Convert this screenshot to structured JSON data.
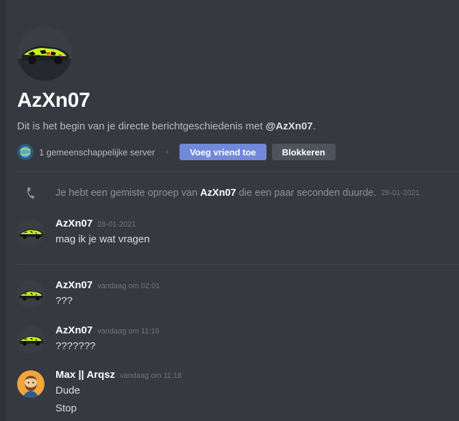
{
  "colors": {
    "background": "#36393f",
    "sidebar_strip": "#2f3136",
    "primary_button": "#7289da",
    "secondary_button": "#4f545c",
    "avatar_lime": "#c8f51e",
    "max_avatar_bg": "#f0a63a"
  },
  "header": {
    "avatar_icon": "lime-camo-supercar-avatar",
    "title": "AzXn07",
    "subtitle_prefix": "Dit is het begin van je directe berichtgeschiedenis met ",
    "subtitle_mention": "@AzXn07",
    "subtitle_suffix": ".",
    "mutual_server_icon": "planet-server-icon",
    "mutual_servers": "1 gemeenschappelijke server",
    "add_friend_label": "Voeg vriend toe",
    "block_label": "Blokkeren"
  },
  "call": {
    "icon": "missed-call-phone-icon",
    "prefix": "Je hebt een gemiste oproep van ",
    "caller": "AzXn07",
    "suffix": " die een paar seconden duurde.",
    "timestamp": "28-01-2021"
  },
  "messages": [
    {
      "author": "AzXn07",
      "timestamp": "28-01-2021",
      "lines": [
        "mag ik je wat vragen"
      ]
    },
    {
      "author": "AzXn07",
      "timestamp": "vandaag om 02:01",
      "lines": [
        "???"
      ]
    },
    {
      "author": "AzXn07",
      "timestamp": "vandaag om 11:18",
      "lines": [
        "???????"
      ]
    },
    {
      "author": "Max || Arqsz",
      "timestamp": "vandaag om 11:18",
      "lines": [
        "Dude",
        "Stop"
      ]
    }
  ]
}
